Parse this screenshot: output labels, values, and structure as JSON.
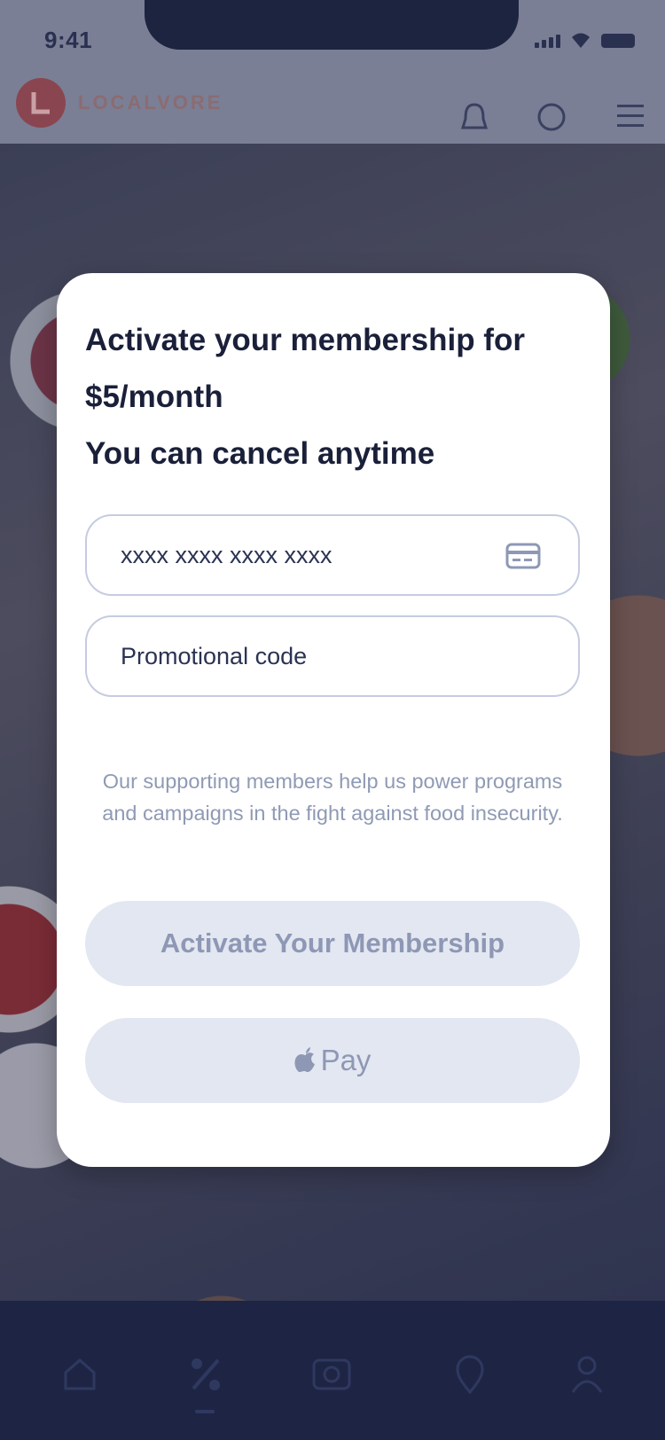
{
  "status_bar": {
    "time": "9:41"
  },
  "header": {
    "brand": "LOCALVORE"
  },
  "modal": {
    "title_line1": "Activate your membership for",
    "title_line2": "$5/month",
    "title_line3": "You can cancel anytime",
    "card_field": {
      "placeholder": "xxxx xxxx xxxx xxxx",
      "icon": "credit-card-icon"
    },
    "promo_field": {
      "placeholder": "Promotional code"
    },
    "info_text_line1": "Our supporting members help us power programs",
    "info_text_line2": "and campaigns in the fight against food insecurity.",
    "activate_button": "Activate Your Membership",
    "apple_pay_label": "Pay"
  },
  "colors": {
    "modal_bg": "#ffffff",
    "title": "#1a2039",
    "button_bg": "#e3e7f1",
    "button_text": "#8e98b5",
    "nav_bg": "#1e2544"
  }
}
